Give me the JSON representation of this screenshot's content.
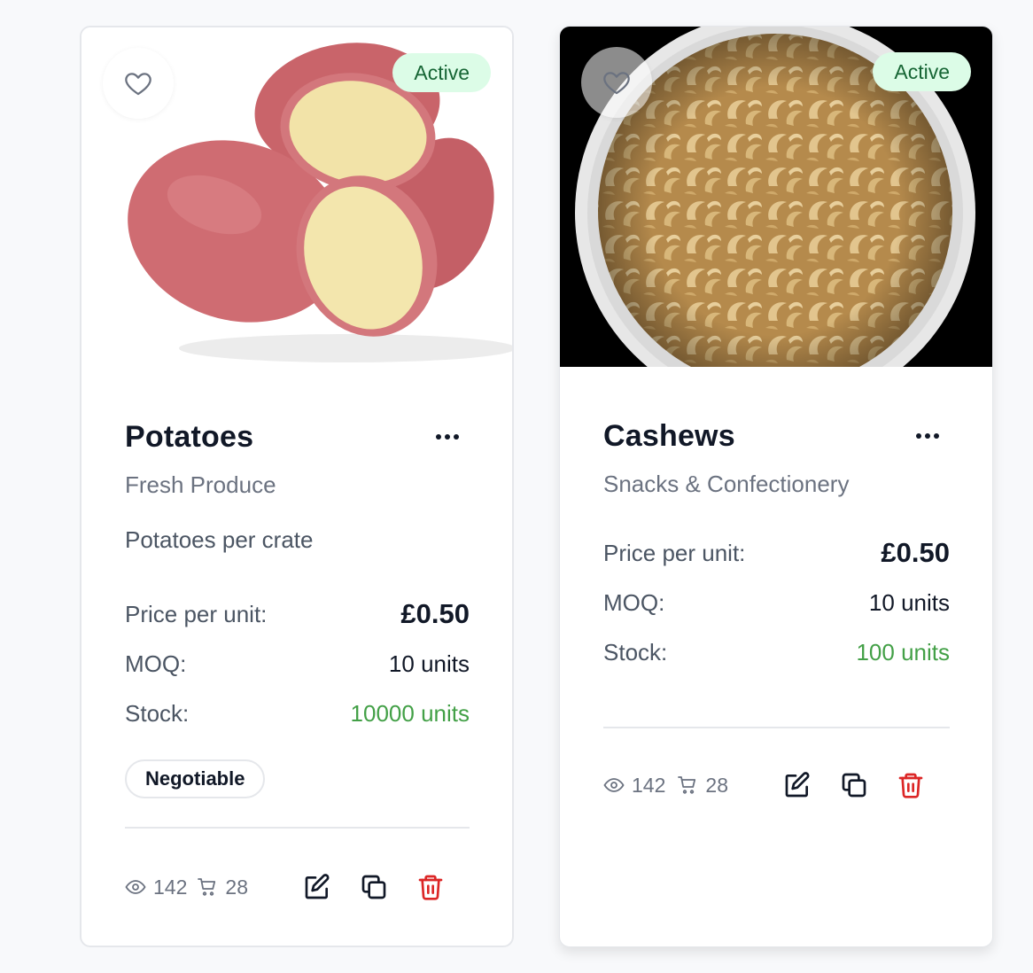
{
  "products": [
    {
      "name": "Potatoes",
      "category": "Fresh Produce",
      "description": "Potatoes per crate",
      "status": "Active",
      "price_label": "Price per unit:",
      "price": "£0.50",
      "moq_label": "MOQ:",
      "moq": "10 units",
      "stock_label": "Stock:",
      "stock": "10000 units",
      "tag": "Negotiable",
      "views": "142",
      "cart_adds": "28",
      "image": "red-potatoes-photo"
    },
    {
      "name": "Cashews",
      "category": "Snacks & Confectionery",
      "status": "Active",
      "price_label": "Price per unit:",
      "price": "£0.50",
      "moq_label": "MOQ:",
      "moq": "10 units",
      "stock_label": "Stock:",
      "stock": "100 units",
      "views": "142",
      "cart_adds": "28",
      "image": "cashews-in-bowl-photo"
    }
  ],
  "icons": {
    "favorite": "heart-icon",
    "more": "more-options-icon",
    "views": "eye-icon",
    "cart": "cart-icon",
    "edit": "edit-icon",
    "duplicate": "copy-icon",
    "delete": "trash-icon"
  },
  "colors": {
    "badge_bg": "#dcfce7",
    "badge_text": "#166534",
    "stock_text": "#43a047",
    "delete_icon": "#dc2626"
  }
}
